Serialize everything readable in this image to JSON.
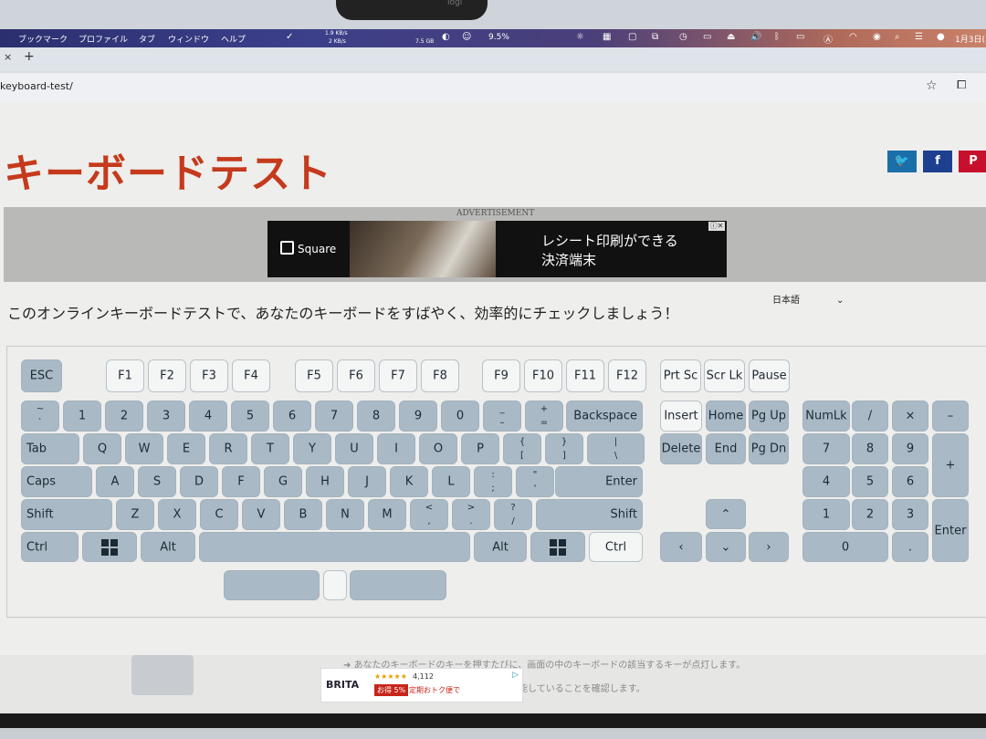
{
  "webcam": {
    "brand": "logi"
  },
  "menubar": {
    "items": [
      "ブックマーク",
      "プロファイル",
      "タブ",
      "ウィンドウ",
      "ヘルプ"
    ],
    "net_up": "1.9 KB/s",
    "net_down": "2 KB/s",
    "mem": "7.5 GB",
    "cpu": "9.5%",
    "date": "1月3日("
  },
  "browser": {
    "url": "keyboard-test/",
    "close_tab": "×",
    "new_tab": "+"
  },
  "page": {
    "title": "キーボードテスト",
    "social": [
      {
        "name": "twitter",
        "glyph": "🐦",
        "color": "#1b6fa8"
      },
      {
        "name": "facebook",
        "glyph": "f",
        "color": "#1d3f8f"
      },
      {
        "name": "pinterest",
        "glyph": "P",
        "color": "#c8102e"
      }
    ],
    "ad_label": "ADVERTISEMENT",
    "ad": {
      "brand": "Square",
      "line1": "レシート印刷ができる",
      "line2": "決済端末"
    },
    "language": "日本語",
    "intro": "このオンラインキーボードテストで、あなたのキーボードをすばやく、効率的にチェックしましょう！",
    "note1": "あなたのキーボードのキーを押すたびに、画面の中のキーボードの該当するキーが点灯します。",
    "note2": "能していることを確認します。",
    "ad2": {
      "brand": "BRITA",
      "stars": "★★★★★",
      "count": "4,112",
      "off": "お得 5%",
      "teiki": "定期おトク便で"
    }
  },
  "keyboard": {
    "fn": [
      "ESC",
      "F1",
      "F2",
      "F3",
      "F4",
      "F5",
      "F6",
      "F7",
      "F8",
      "F9",
      "F10",
      "F11",
      "F12"
    ],
    "nav_top": [
      "Prt Sc",
      "Scr Lk",
      "Pause"
    ],
    "row1": [
      "`",
      "1",
      "2",
      "3",
      "4",
      "5",
      "6",
      "7",
      "8",
      "9",
      "0",
      "–",
      "="
    ],
    "row1_shift": [
      "~",
      "",
      "",
      "",
      "",
      "",
      "",
      "",
      "",
      "",
      "",
      "_",
      "+"
    ],
    "backspace": "Backspace",
    "row2": [
      "Tab",
      "Q",
      "W",
      "E",
      "R",
      "T",
      "Y",
      "U",
      "I",
      "O",
      "P",
      "[",
      "]",
      "\\"
    ],
    "row2_shift": [
      "",
      "",
      "",
      "",
      "",
      "",
      "",
      "",
      "",
      "",
      "",
      "{",
      "}",
      "|"
    ],
    "row3": [
      "Caps",
      "A",
      "S",
      "D",
      "F",
      "G",
      "H",
      "J",
      "K",
      "L",
      ";",
      "'"
    ],
    "row3_shift": [
      "",
      "",
      "",
      "",
      "",
      "",
      "",
      "",
      "",
      "",
      ":",
      "\""
    ],
    "enter": "Enter",
    "row4": [
      "Shift",
      "Z",
      "X",
      "C",
      "V",
      "B",
      "N",
      "M",
      ",",
      ".",
      "/",
      "Shift"
    ],
    "row4_shift": [
      "",
      "",
      "",
      "",
      "",
      "",
      "",
      "",
      "<",
      ">",
      "?",
      ""
    ],
    "row5": [
      "Ctrl",
      "Alt",
      "Alt",
      "Ctrl"
    ],
    "nav": [
      "Insert",
      "Home",
      "Pg Up",
      "Delete",
      "End",
      "Pg Dn"
    ],
    "arrows": {
      "up": "⌃",
      "left": "‹",
      "down": "⌄",
      "right": "›"
    },
    "numpad": [
      "NumLk",
      "/",
      "×",
      "–",
      "7",
      "8",
      "9",
      "+",
      "4",
      "5",
      "6",
      "1",
      "2",
      "3",
      "Enter",
      "0",
      "."
    ]
  }
}
